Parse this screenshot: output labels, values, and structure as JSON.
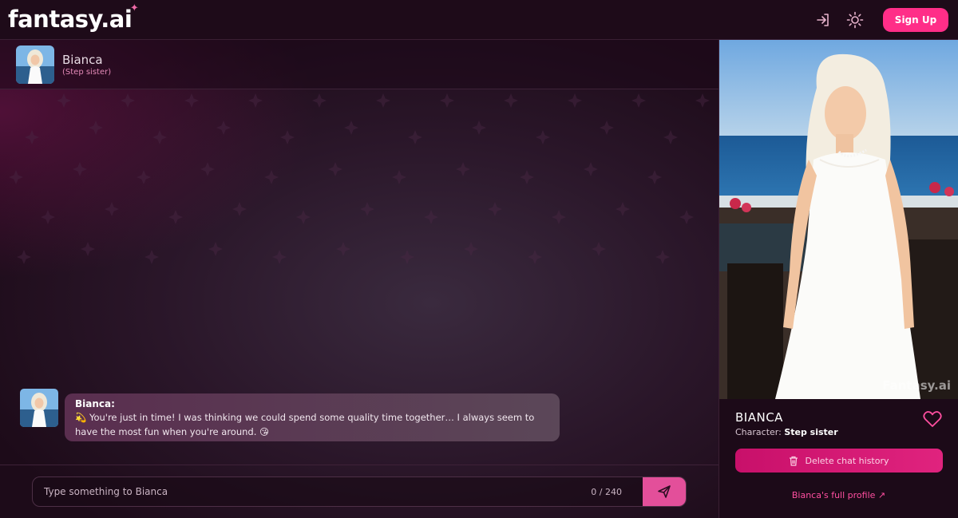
{
  "header": {
    "logo": "fantasy.ai",
    "signup_label": "Sign Up",
    "icons": [
      "login-icon",
      "sun-icon"
    ]
  },
  "chat": {
    "character_name": "Bianca",
    "character_role": "(Step sister)",
    "messages": [
      {
        "sender": "Bianca:",
        "text": "💫 You're just in time! I was thinking we could spend some quality time together… I always seem to have the most fun when you're around. 😘"
      }
    ],
    "input_placeholder": "Type something to Bianca",
    "counter": "0 / 240"
  },
  "profile": {
    "name": "BIANCA",
    "character_label": "Character:",
    "character_value": "Step sister",
    "delete_label": "Delete chat history",
    "full_profile_label": "Bianca's full profile ↗",
    "watermark": "Fantasy.ai"
  },
  "colors": {
    "accent": "#ff2e88",
    "background": "#1c0a18"
  }
}
